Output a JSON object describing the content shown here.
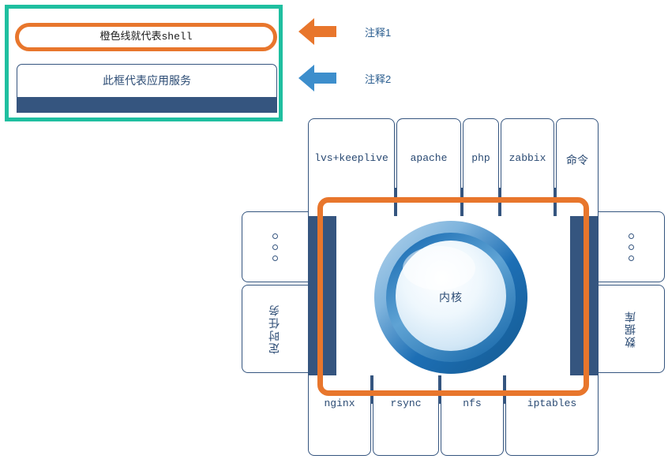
{
  "colors": {
    "teal_border": "#1fbfa0",
    "orange_shell": "#e8762c",
    "dark_blue_bar": "#35557f",
    "text_blue": "#2a4a73",
    "annotation_blue": "#3d8ecc",
    "kernel_ring_dark": "#1d6fb5",
    "kernel_ring_light": "#a9cde8",
    "kernel_face": "#eaf4fc"
  },
  "legend": {
    "shell_note": "橙色线就代表shell",
    "service_note": "此框代表应用服务"
  },
  "annotations": [
    {
      "id": "annot-1",
      "label": "注释1",
      "arrow_color": "#e8762c",
      "arrow_direction": "left"
    },
    {
      "id": "annot-2",
      "label": "注释2",
      "arrow_color": "#3d8ecc",
      "arrow_direction": "left"
    }
  ],
  "diagram": {
    "kernel_label": "内核",
    "top_row": [
      {
        "label": "lvs+keeplive"
      },
      {
        "label": "apache"
      },
      {
        "label": "php"
      },
      {
        "label": "zabbix"
      },
      {
        "label": "命令"
      }
    ],
    "bottom_row": [
      {
        "label": "nginx"
      },
      {
        "label": "rsync"
      },
      {
        "label": "nfs"
      },
      {
        "label": "iptables"
      }
    ],
    "left_column": [
      {
        "label": "",
        "kind": "ellipsis-dots"
      },
      {
        "label": "定时任务",
        "kind": "vertical-text"
      }
    ],
    "right_column": [
      {
        "label": "",
        "kind": "ellipsis-dots"
      },
      {
        "label": "数据库",
        "kind": "vertical-text"
      }
    ]
  }
}
